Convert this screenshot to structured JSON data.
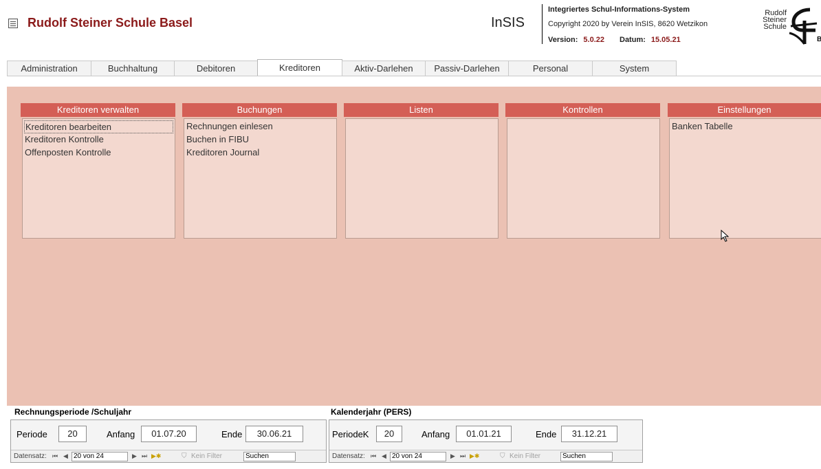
{
  "header": {
    "school_title": "Rudolf Steiner Schule Basel",
    "app_name": "InSIS",
    "info_title": "Integriertes Schul-Informations-System",
    "copyright": "Copyright 2020 by Verein InSIS, 8620 Wetzikon",
    "version_label": "Version:",
    "version_value": "5.0.22",
    "date_label": "Datum:",
    "date_value": "15.05.21",
    "logo_line1": "Rudolf",
    "logo_line2": "Steiner",
    "logo_line3": "Schule",
    "logo_letter": "B"
  },
  "tabs": [
    {
      "label": "Administration"
    },
    {
      "label": "Buchhaltung"
    },
    {
      "label": "Debitoren"
    },
    {
      "label": "Kreditoren"
    },
    {
      "label": "Aktiv-Darlehen"
    },
    {
      "label": "Passiv-Darlehen"
    },
    {
      "label": "Personal"
    },
    {
      "label": "System"
    }
  ],
  "active_tab": "Kreditoren",
  "groups": [
    {
      "title": "Kreditoren verwalten",
      "items": [
        "Kreditoren bearbeiten",
        "Kreditoren Kontrolle",
        "Offenposten Kontrolle"
      ]
    },
    {
      "title": "Buchungen",
      "items": [
        "Rechnungen einlesen",
        "Buchen in FIBU",
        "Kreditoren Journal"
      ]
    },
    {
      "title": "Listen",
      "items": []
    },
    {
      "title": "Kontrollen",
      "items": []
    },
    {
      "title": "Einstellungen",
      "items": [
        "Banken Tabelle"
      ]
    }
  ],
  "left_form": {
    "section_label": "Rechnungsperiode /Schuljahr",
    "periode_label": "Periode",
    "periode_value": "20",
    "anfang_label": "Anfang",
    "anfang_value": "01.07.20",
    "ende_label": "Ende",
    "ende_value": "30.06.21",
    "nav": {
      "label": "Datensatz:",
      "record": "20 von 24",
      "filter": "Kein Filter",
      "search": "Suchen"
    }
  },
  "right_form": {
    "section_label": "Kalenderjahr (PERS)",
    "periode_label": "PeriodeK",
    "periode_value": "20",
    "anfang_label": "Anfang",
    "anfang_value": "01.01.21",
    "ende_label": "Ende",
    "ende_value": "31.12.21",
    "nav": {
      "label": "Datensatz:",
      "record": "20 von 24",
      "filter": "Kein Filter",
      "search": "Suchen"
    }
  },
  "colors": {
    "title_red": "#8b1a1a",
    "group_header": "#d45f56",
    "panel_bg": "#ebc1b3",
    "group_body": "#f3d8cf"
  }
}
